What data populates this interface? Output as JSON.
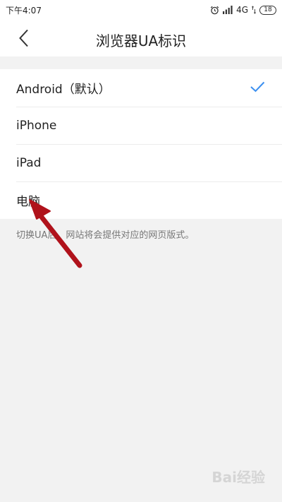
{
  "status": {
    "time": "下午4:07",
    "network": "4G",
    "battery": "18"
  },
  "header": {
    "title": "浏览器UA标识"
  },
  "options": [
    {
      "label": "Android（默认）",
      "selected": true
    },
    {
      "label": "iPhone",
      "selected": false
    },
    {
      "label": "iPad",
      "selected": false
    },
    {
      "label": "电脑",
      "selected": false
    }
  ],
  "hint": "切换UA后，网站将会提供对应的网页版式。",
  "watermark": "Bai经验",
  "colors": {
    "accent": "#3b8ff0",
    "annotation_arrow": "#b0121b"
  }
}
